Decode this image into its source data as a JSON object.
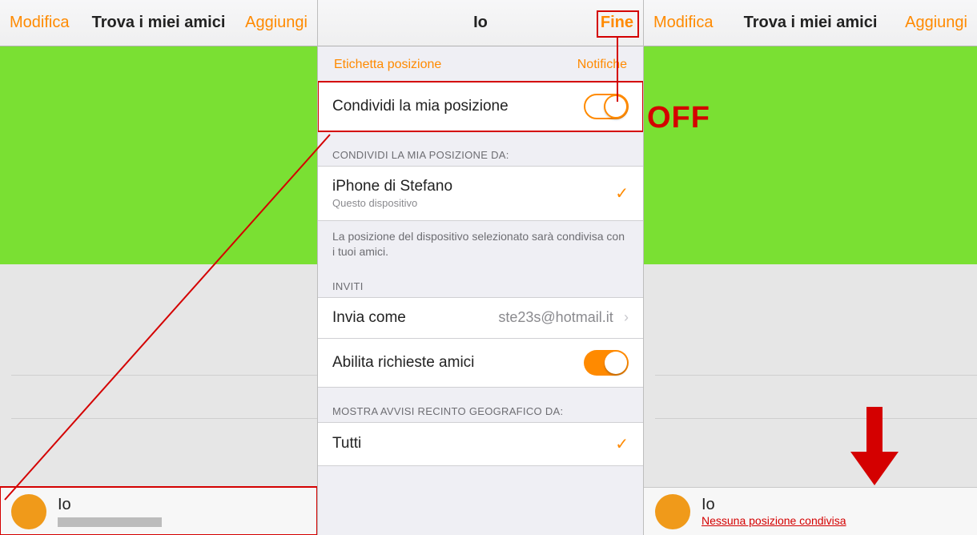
{
  "left": {
    "nav": {
      "edit": "Modifica",
      "title": "Trova i miei amici",
      "add": "Aggiungi"
    },
    "me": {
      "name": "Io"
    }
  },
  "mid": {
    "nav": {
      "title": "Io",
      "done": "Fine"
    },
    "tabs": {
      "left": "Etichetta posizione",
      "right": "Notifiche"
    },
    "share_toggle": {
      "label": "Condividi la mia posizione"
    },
    "section_from": {
      "header": "CONDIVIDI LA MIA POSIZIONE DA:"
    },
    "device": {
      "name": "iPhone di Stefano",
      "sub": "Questo dispositivo"
    },
    "footer_device": "La posizione del dispositivo selezionato sarà condivisa con i tuoi amici.",
    "section_invites": {
      "header": "INVITI"
    },
    "send_as": {
      "label": "Invia come",
      "value": "ste23s@hotmail.it"
    },
    "friend_req": {
      "label": "Abilita richieste amici"
    },
    "section_geo": {
      "header": "MOSTRA AVVISI RECINTO GEOGRAFICO DA:"
    },
    "geo_all": {
      "label": "Tutti"
    }
  },
  "right": {
    "nav": {
      "edit": "Modifica",
      "title": "Trova i miei amici",
      "add": "Aggiungi"
    },
    "me": {
      "name": "Io",
      "sub": "Nessuna posizione condivisa"
    }
  },
  "annotations": {
    "off_label": "OFF"
  }
}
